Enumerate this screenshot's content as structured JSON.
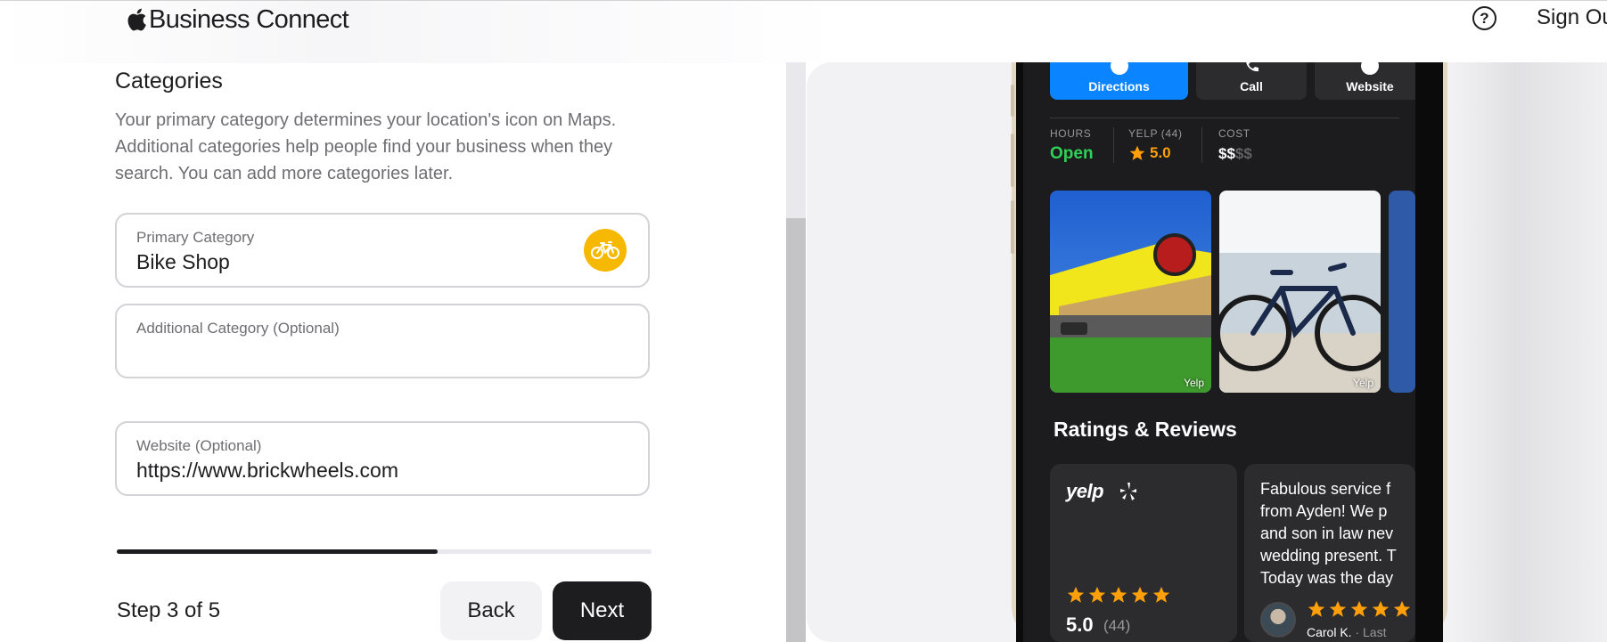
{
  "header": {
    "brand": "Business Connect",
    "help_icon": "question-circle-icon",
    "sign_out": "Sign Ou"
  },
  "form": {
    "section_title": "Categories",
    "section_desc": "Your primary category determines your location's icon on Maps. Additional categories help people find your business when they search. You can add more categories later.",
    "primary_category": {
      "label": "Primary Category",
      "value": "Bike Shop",
      "icon": "bicycle-icon",
      "icon_color": "#f6b800"
    },
    "additional_category": {
      "label": "Additional Category (Optional)",
      "value": ""
    },
    "website": {
      "label": "Website (Optional)",
      "value": "https://www.brickwheels.com"
    },
    "progress": 0.6,
    "step_text": "Step 3 of 5",
    "back_label": "Back",
    "next_label": "Next"
  },
  "preview": {
    "actions": [
      {
        "label": "Directions",
        "icon": "directions-icon",
        "color": "#0a84ff"
      },
      {
        "label": "Call",
        "icon": "phone-icon"
      },
      {
        "label": "Website",
        "icon": "compass-icon"
      }
    ],
    "stats": {
      "hours_label": "HOURS",
      "hours_value": "Open",
      "yelp_label": "YELP (44)",
      "yelp_value": "5.0",
      "cost_label": "COST",
      "cost_on": "$$",
      "cost_off": "$$"
    },
    "photos": [
      {
        "credit": "Yelp",
        "subject": "storefront"
      },
      {
        "credit": "Yelp",
        "subject": "bicycle"
      }
    ],
    "reviews_title": "Ratings & Reviews",
    "yelp_card": {
      "logo": "yelp",
      "score": "5.0",
      "count": "(44)",
      "stars": 5
    },
    "review_card": {
      "lines": [
        "Fabulous service f",
        "from Ayden! We p",
        "and son in law nev",
        "wedding present. T",
        "Today was the day"
      ],
      "reviewer": "Carol K.",
      "date": "· Last",
      "stars": 5
    },
    "colors": {
      "accent_blue": "#0a84ff",
      "open_green": "#30d158",
      "star_orange": "#ff9f0a"
    }
  }
}
